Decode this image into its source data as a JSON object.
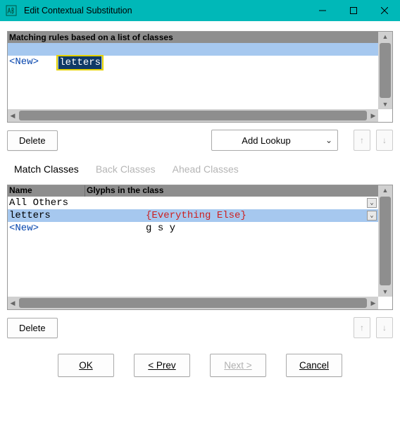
{
  "window": {
    "title": "Edit Contextual Substitution"
  },
  "rules": {
    "header": "Matching rules based on a list of classes",
    "items": [
      "letters",
      "<New>"
    ],
    "selected_index": 0
  },
  "toolbar": {
    "delete_label": "Delete",
    "add_lookup_label": "Add Lookup"
  },
  "tabs": {
    "match": "Match Classes",
    "back": "Back Classes",
    "ahead": "Ahead Classes",
    "active": "match"
  },
  "classes": {
    "col_name": "Name",
    "col_glyphs": "Glyphs in the class",
    "rows": [
      {
        "name": "All Others",
        "glyphs": "{Everything Else}",
        "special": true
      },
      {
        "name": "letters",
        "glyphs": "g s y",
        "special": false
      },
      {
        "name": "<New>",
        "glyphs": "",
        "special": false
      }
    ],
    "selected_index": 1
  },
  "toolbar2": {
    "delete_label": "Delete"
  },
  "footer": {
    "ok": "OK",
    "prev": "< Prev",
    "next": "Next >",
    "cancel": "Cancel"
  }
}
